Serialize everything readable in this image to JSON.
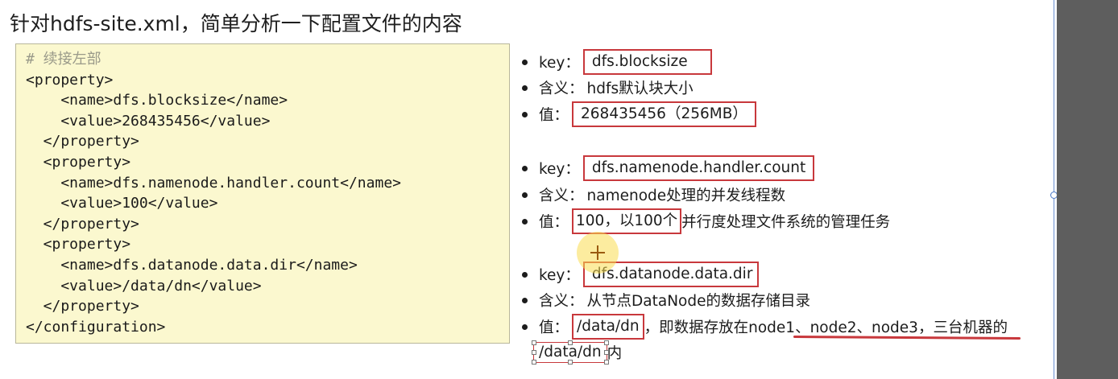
{
  "title": "针对hdfs-site.xml，简单分析一下配置文件的内容",
  "code": {
    "lines": [
      "# 续接左部",
      "<property>",
      "    <name>dfs.blocksize</name>",
      "    <value>268435456</value>",
      "  </property>",
      "  <property>",
      "    <name>dfs.namenode.handler.count</name>",
      "    <value>100</value>",
      "  </property>",
      "  <property>",
      "    <name>dfs.datanode.data.dir</name>",
      "    <value>/data/dn</value>",
      "  </property>",
      "</configuration>"
    ]
  },
  "notes": {
    "block1": {
      "key_label": "key：",
      "key_value": "dfs.blocksize",
      "meaning_label": "含义：",
      "meaning_value": "hdfs默认块大小",
      "value_label": "值：",
      "value_value": "268435456（256MB）"
    },
    "block2": {
      "key_label": "key：",
      "key_value": "dfs.namenode.handler.count",
      "meaning_label": "含义：",
      "meaning_value": "namenode处理的并发线程数",
      "value_label": "值：",
      "value_boxed": "100，以100个",
      "value_rest": "并行度处理文件系统的管理任务"
    },
    "block3": {
      "key_label": "key：",
      "key_value": "dfs.datanode.data.dir",
      "meaning_label": "含义：",
      "meaning_value": "从节点DataNode的数据存储目录",
      "value_label": "值：",
      "value_boxed": "/data/dn",
      "value_mid": "，即数据存放在",
      "value_underlined": "node1、node2、node3，三台机器的",
      "continuation_boxed": "/data/dn",
      "continuation_rest": "内"
    }
  },
  "colors": {
    "highlight_box": "#c8383c",
    "code_background": "#fbf8cf",
    "side_panel": "#5e5e5e"
  }
}
